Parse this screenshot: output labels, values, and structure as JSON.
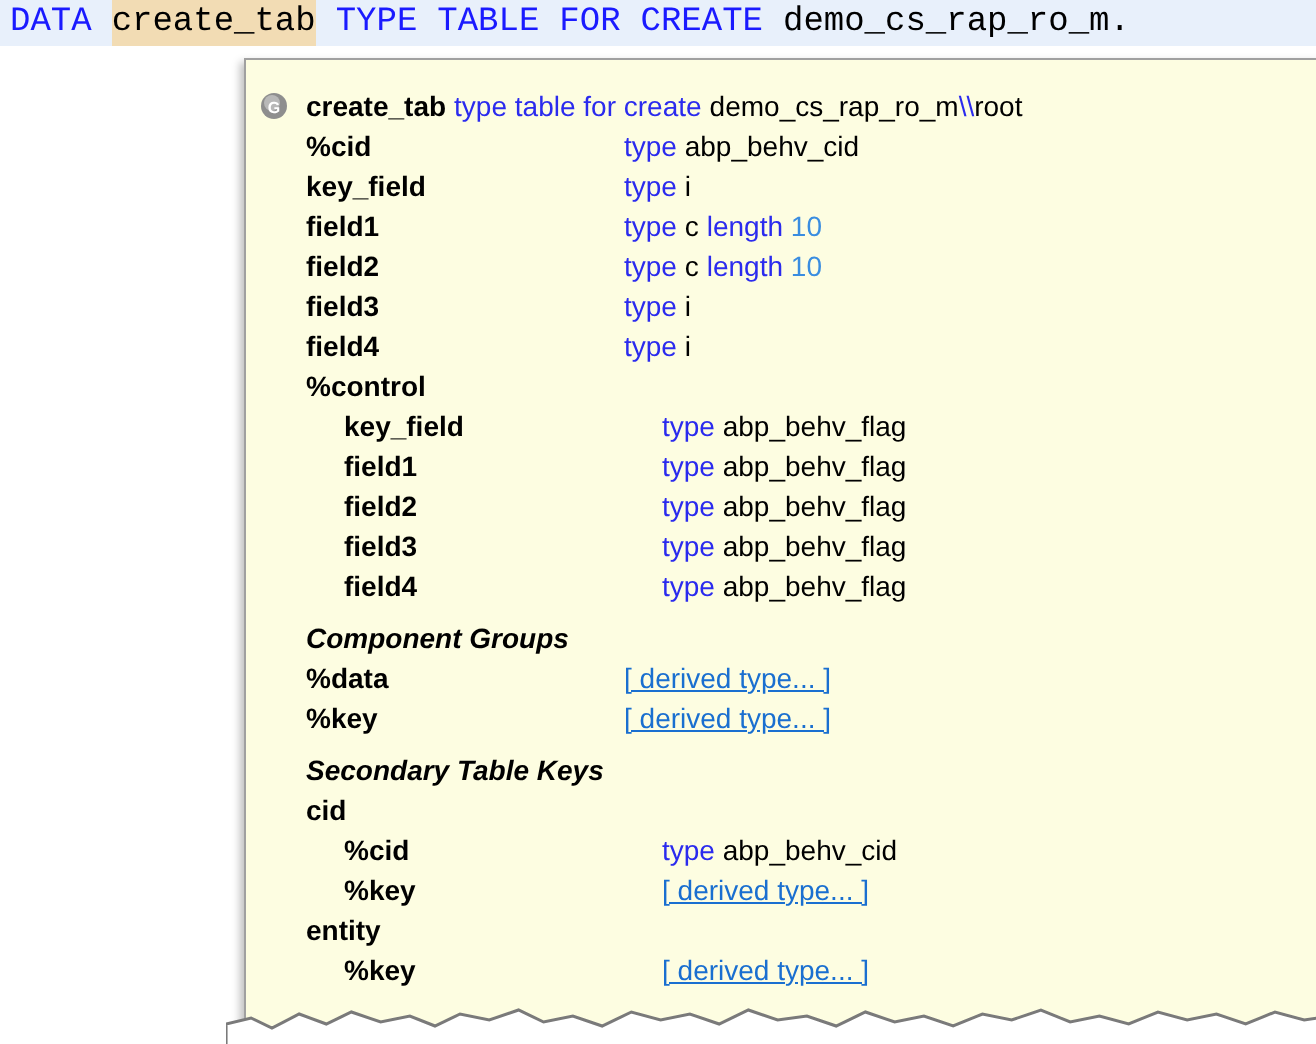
{
  "code_line": {
    "tokens": [
      {
        "text": "DATA",
        "kind": "keyword"
      },
      {
        "text": "create_tab",
        "kind": "highlight"
      },
      {
        "text": "TYPE",
        "kind": "keyword"
      },
      {
        "text": "TABLE",
        "kind": "keyword"
      },
      {
        "text": "FOR",
        "kind": "keyword"
      },
      {
        "text": "CREATE",
        "kind": "keyword"
      },
      {
        "text": "demo_cs_rap_ro_m.",
        "kind": "name"
      }
    ]
  },
  "tooltip": {
    "header": {
      "icon_letter": "G",
      "name": "create_tab",
      "keyword": "type table for create",
      "entity": "demo_cs_rap_ro_m",
      "separator": "\\\\",
      "node": "root"
    },
    "sections": [
      {
        "rows": [
          {
            "kind": "typed",
            "name": "%cid",
            "keyword": "type",
            "type": "abp_behv_cid"
          },
          {
            "kind": "typed",
            "name": "key_field",
            "keyword": "type",
            "type": "i"
          },
          {
            "kind": "typed",
            "name": "field1",
            "keyword": "type",
            "type": "c",
            "length_keyword": "length",
            "length": "10"
          },
          {
            "kind": "typed",
            "name": "field2",
            "keyword": "type",
            "type": "c",
            "length_keyword": "length",
            "length": "10"
          },
          {
            "kind": "typed",
            "name": "field3",
            "keyword": "type",
            "type": "i"
          },
          {
            "kind": "typed",
            "name": "field4",
            "keyword": "type",
            "type": "i"
          },
          {
            "kind": "group",
            "name": "%control",
            "children": [
              {
                "kind": "typed",
                "name": "key_field",
                "keyword": "type",
                "type": "abp_behv_flag"
              },
              {
                "kind": "typed",
                "name": "field1",
                "keyword": "type",
                "type": "abp_behv_flag"
              },
              {
                "kind": "typed",
                "name": "field2",
                "keyword": "type",
                "type": "abp_behv_flag"
              },
              {
                "kind": "typed",
                "name": "field3",
                "keyword": "type",
                "type": "abp_behv_flag"
              },
              {
                "kind": "typed",
                "name": "field4",
                "keyword": "type",
                "type": "abp_behv_flag"
              }
            ]
          }
        ]
      },
      {
        "title": "Component Groups",
        "rows": [
          {
            "kind": "link",
            "name": "%data",
            "link": "[ derived type... ]"
          },
          {
            "kind": "link",
            "name": "%key",
            "link": "[ derived type... ]"
          }
        ]
      },
      {
        "title": "Secondary Table Keys",
        "rows": [
          {
            "kind": "group",
            "name": "cid",
            "children": [
              {
                "kind": "typed",
                "name": "%cid",
                "keyword": "type",
                "type": "abp_behv_cid"
              },
              {
                "kind": "link",
                "name": "%key",
                "link": "[ derived type... ]"
              }
            ]
          },
          {
            "kind": "group",
            "name": "entity",
            "children": [
              {
                "kind": "link",
                "name": "%key",
                "link": "[ derived type... ]"
              }
            ]
          }
        ]
      }
    ]
  }
}
